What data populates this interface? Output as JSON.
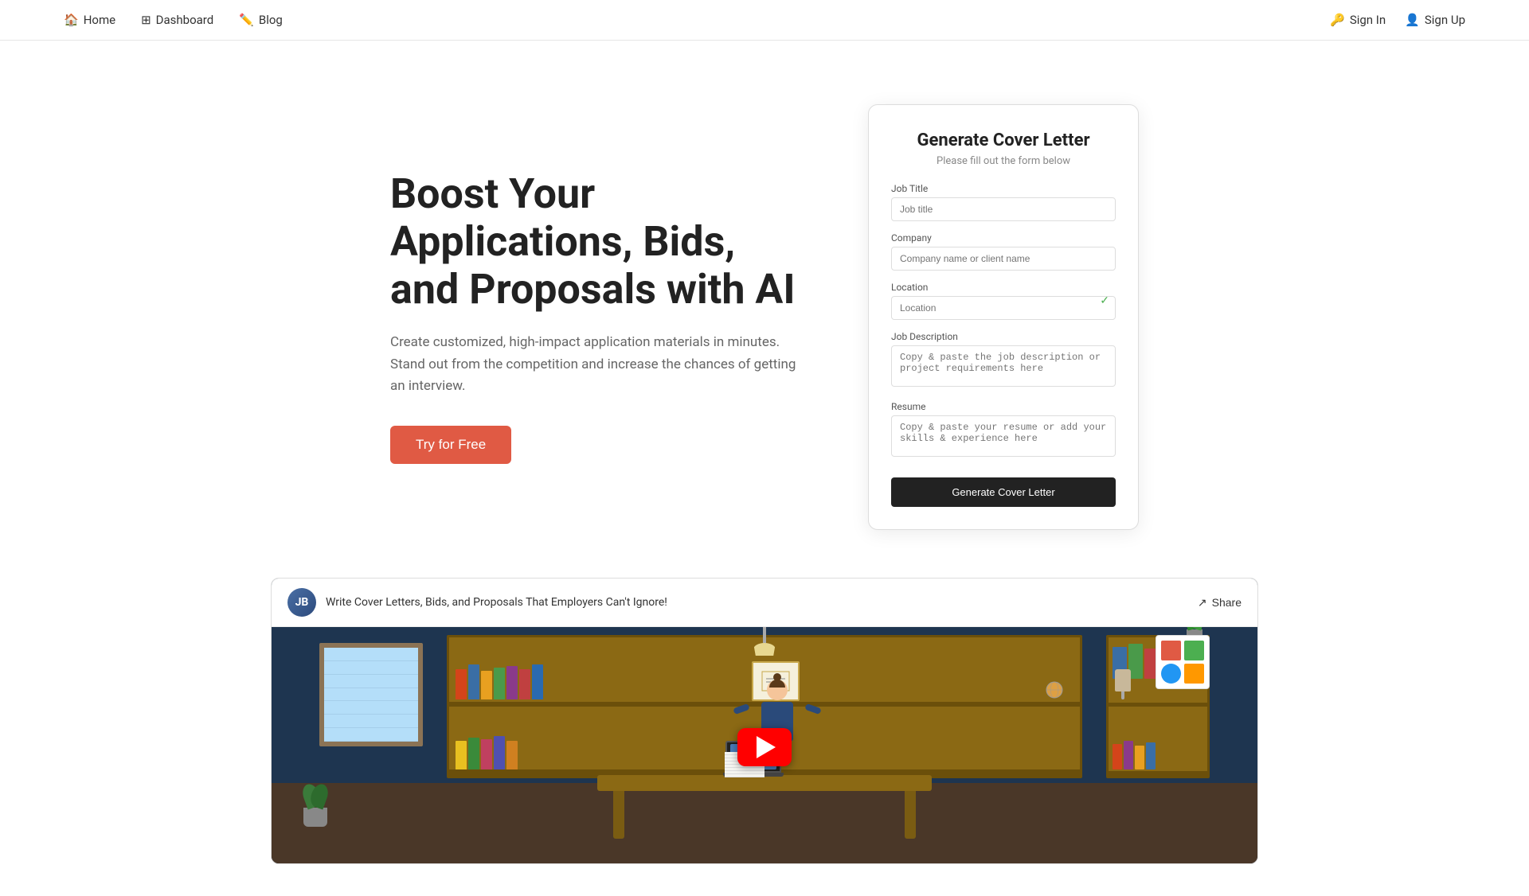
{
  "nav": {
    "links": [
      {
        "id": "home",
        "label": "Home",
        "icon": "home"
      },
      {
        "id": "dashboard",
        "label": "Dashboard",
        "icon": "dashboard"
      },
      {
        "id": "blog",
        "label": "Blog",
        "icon": "blog"
      }
    ],
    "auth": [
      {
        "id": "signin",
        "label": "Sign In",
        "icon": "signin"
      },
      {
        "id": "signup",
        "label": "Sign Up",
        "icon": "signup"
      }
    ]
  },
  "hero": {
    "title": "Boost Your Applications, Bids, and Proposals with AI",
    "subtitle": "Create customized, high-impact application materials in minutes. Stand out from the competition and increase the chances of getting an interview.",
    "cta_label": "Try for Free"
  },
  "form_card": {
    "title": "Generate Cover Letter",
    "subtitle": "Please fill out the form below",
    "fields": [
      {
        "id": "job-title",
        "label": "Job Title",
        "placeholder": "Job title"
      },
      {
        "id": "company",
        "label": "Company",
        "placeholder": "Company name or client name"
      },
      {
        "id": "location",
        "label": "Location",
        "placeholder": "Location"
      },
      {
        "id": "job-description",
        "label": "Job Description",
        "placeholder": "Copy & paste the job description or project requirements here",
        "multiline": true
      },
      {
        "id": "resume",
        "label": "Resume",
        "placeholder": "Copy & paste your resume or add your skills & experience here",
        "multiline": true
      }
    ],
    "submit_label": "Generate Cover Letter"
  },
  "video": {
    "channel_label": "JB",
    "title": "Write Cover Letters, Bids, and Proposals That Employers Can't Ignore!",
    "share_label": "Share"
  }
}
